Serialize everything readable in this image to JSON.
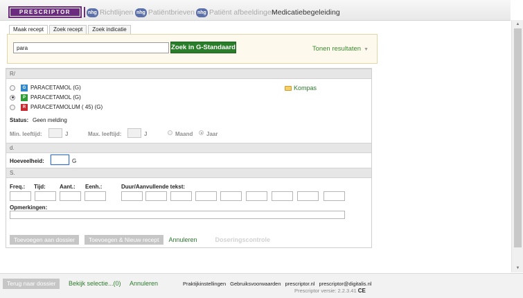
{
  "nav": {
    "brand": "PRESCRIPTOR",
    "items": [
      {
        "label": "Richtlijnen",
        "icon": "nhg-icon"
      },
      {
        "label": "Patiëntbrieven",
        "icon": "nhg-icon"
      },
      {
        "label": "Patiënt afbeeldingen",
        "icon": "nhg-icon"
      },
      {
        "label": "Medicatiebegeleiding"
      }
    ],
    "nhg_text": "nhg"
  },
  "tabs": [
    {
      "label": "Maak recept",
      "active": true
    },
    {
      "label": "Zoek recept"
    },
    {
      "label": "Zoek indicatie"
    }
  ],
  "search": {
    "value": "para",
    "button": "Zoek in G-Standaard",
    "results_toggle": "Tonen resultaten",
    "chevron": "▼"
  },
  "sections": {
    "r": "R/",
    "d": "d.",
    "s": "S."
  },
  "meds": [
    {
      "badge": "G",
      "badge_color": "#2f86c9",
      "name": "PARACETAMOL (G)",
      "checked": false
    },
    {
      "badge": "P",
      "badge_color": "#2e9b37",
      "name": "PARACETAMOL (G)",
      "checked": true
    },
    {
      "badge": "R",
      "badge_color": "#c9282f",
      "name": "PARACETAMOLUM ( 45) (G)",
      "checked": false
    }
  ],
  "kompas": "Kompas",
  "status": {
    "label": "Status:",
    "value": "Geen melding"
  },
  "age": {
    "min_label": "Min. leeftijd:",
    "max_label": "Max. leeftijd:",
    "unit": "J",
    "maand": "Maand",
    "jaar": "Jaar"
  },
  "quantity": {
    "label": "Hoeveelheid:",
    "unit": "G"
  },
  "dosage": {
    "freq": "Freq.:",
    "tijd": "Tijd:",
    "aant": "Aant.:",
    "eenh": "Eenh.:",
    "duur": "Duur/Aanvullende tekst:",
    "opmerkingen": "Opmerkingen:"
  },
  "actions": {
    "add": "Toevoegen aan dossier",
    "add_new": "Toevoegen & Nieuw recept",
    "cancel": "Annuleren",
    "dose_check": "Doseringscontrole"
  },
  "footer": {
    "back": "Terug naar dossier",
    "selection": "Bekijk selectie...(0)",
    "cancel": "Annuleren",
    "links": [
      "Praktijkinstellingen",
      "Gebruiksvoorwaarden",
      "prescriptor.nl",
      "prescriptor@digitalis.nl"
    ],
    "version": "Prescriptor versie: 2.2.3.41",
    "ce": "CE"
  },
  "colors": {
    "brand": "#6b2c7f",
    "accent_green": "#2d7a2d",
    "search_button": "#2a7d2a"
  }
}
